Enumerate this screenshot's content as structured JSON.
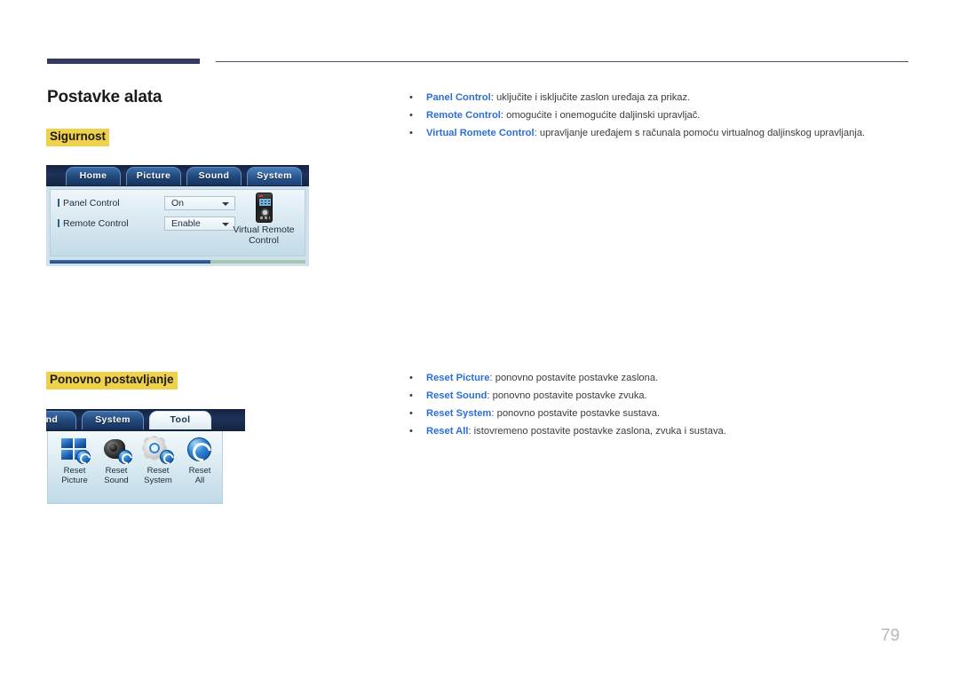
{
  "page": {
    "title": "Postavke alata",
    "number": "79",
    "accent_heading_bg": "#efd14b",
    "term_color": "#2b6fd4",
    "rule_color": "#343a5e"
  },
  "sections": [
    {
      "heading": "Sigurnost",
      "bullets": [
        {
          "bullet": "•",
          "term": "Panel Control",
          "desc": ": uključite i isključite zaslon uređaja za prikaz."
        },
        {
          "bullet": "•",
          "term": "Remote Control",
          "desc": ": omogućite i onemogućite daljinski upravljač."
        },
        {
          "bullet": "•",
          "term": "Virtual Romete Control",
          "desc": ": upravljanje uređajem s računala pomoću virtualnog daljinskog upravljanja."
        }
      ]
    },
    {
      "heading": "Ponovno postavljanje",
      "bullets": [
        {
          "bullet": "•",
          "term": "Reset Picture",
          "desc": ": ponovno postavite postavke zaslona."
        },
        {
          "bullet": "•",
          "term": "Reset Sound",
          "desc": ": ponovno postavite postavke zvuka."
        },
        {
          "bullet": "•",
          "term": "Reset System",
          "desc": ": ponovno postavite postavke sustava."
        },
        {
          "bullet": "•",
          "term": "Reset All",
          "desc": ": istovremeno postavite postavke zaslona, zvuka i sustava."
        }
      ]
    }
  ],
  "osd_security": {
    "tabs": [
      {
        "label": "Home",
        "active": false
      },
      {
        "label": "Picture",
        "active": false
      },
      {
        "label": "Sound",
        "active": false
      },
      {
        "label": "System",
        "active": true
      }
    ],
    "rows": [
      {
        "label": "Panel Control",
        "value": "On"
      },
      {
        "label": "Remote Control",
        "value": "Enable"
      }
    ],
    "virtual_remote": {
      "icon": "remote-control-icon",
      "label_line1": "Virtual Remote",
      "label_line2": "Control"
    }
  },
  "osd_reset": {
    "tabs": [
      {
        "label": "und",
        "active": false
      },
      {
        "label": "System",
        "active": false
      },
      {
        "label": "Tool",
        "active": true
      }
    ],
    "items": [
      {
        "icon": "reset-picture-icon",
        "label": "Reset\nPicture"
      },
      {
        "icon": "reset-sound-icon",
        "label": "Reset\nSound"
      },
      {
        "icon": "reset-system-icon",
        "label": "Reset\nSystem"
      },
      {
        "icon": "reset-all-icon",
        "label": "Reset\nAll"
      }
    ]
  }
}
